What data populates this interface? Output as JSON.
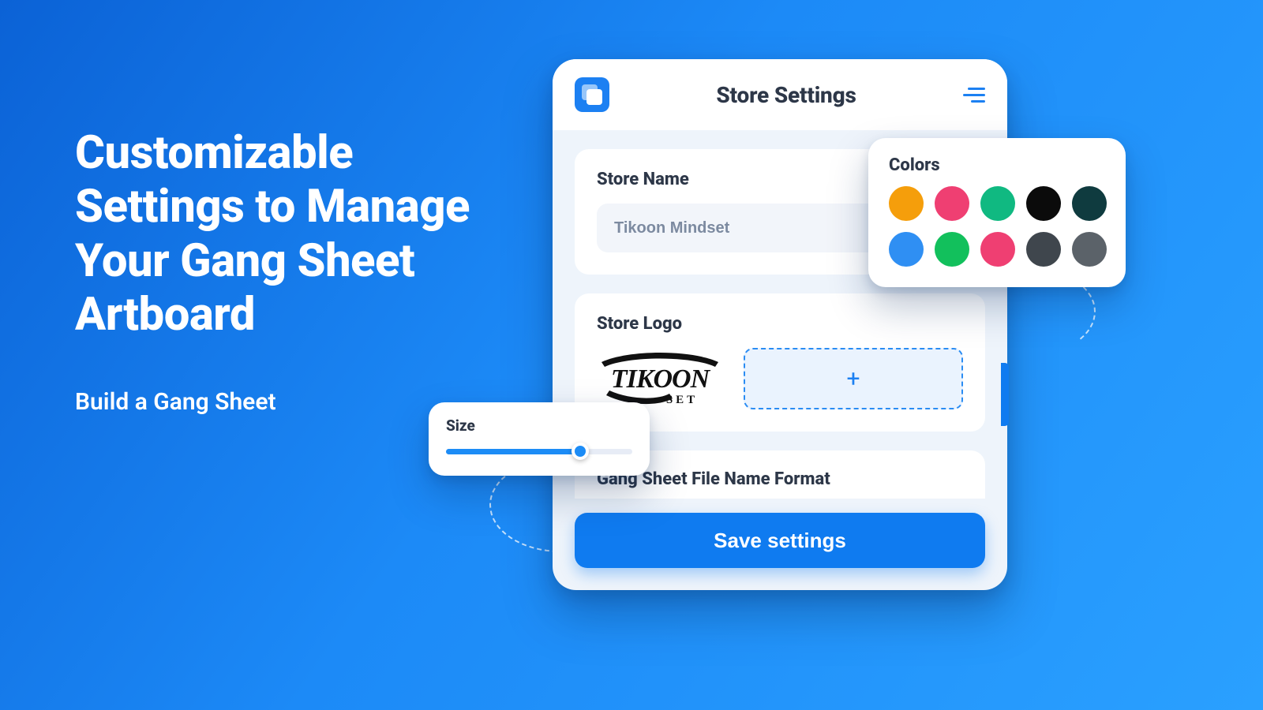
{
  "hero": {
    "title": "Customizable Settings to Manage Your Gang Sheet Artboard",
    "subtitle": "Build a Gang Sheet"
  },
  "card": {
    "title": "Store Settings",
    "store_name_label": "Store Name",
    "store_name_value": "Tikoon Mindset",
    "store_logo_label": "Store Logo",
    "store_logo_brand_top": "TIKOON",
    "store_logo_brand_bottom": "SET",
    "upload_glyph": "+",
    "file_format_label": "Gang Sheet File Name Format",
    "save_label": "Save settings"
  },
  "colors_popover": {
    "title": "Colors",
    "swatches": [
      "#f59e0b",
      "#ef3f72",
      "#10b981",
      "#0b0b0b",
      "#0f3b3f",
      "#2f8ff3",
      "#12c05c",
      "#ef3f72",
      "#3f464d",
      "#5b6269"
    ]
  },
  "size_popover": {
    "title": "Size",
    "percent": 72
  }
}
